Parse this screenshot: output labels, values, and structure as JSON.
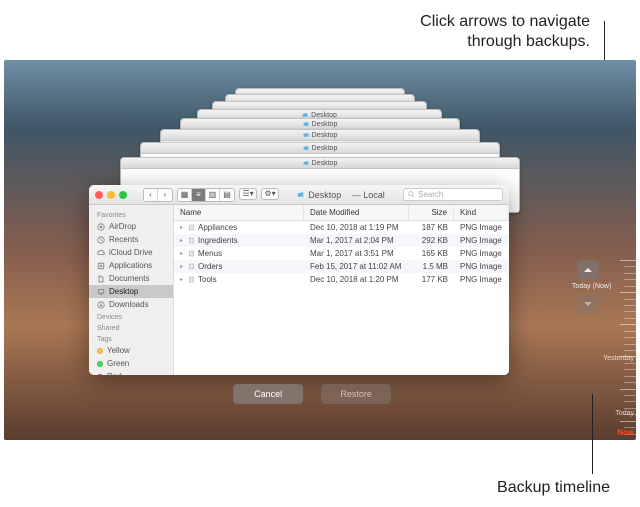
{
  "annotations": {
    "top": "Click arrows to navigate\nthrough backups.",
    "bottom": "Backup timeline"
  },
  "stacked_title": "Desktop",
  "window": {
    "title_folder": "Desktop",
    "title_suffix": "— Local",
    "search_placeholder": "Search"
  },
  "sidebar": {
    "sections": [
      {
        "heading": "Favorites",
        "items": [
          {
            "label": "AirDrop",
            "icon": "airdrop-icon"
          },
          {
            "label": "Recents",
            "icon": "clock-icon"
          },
          {
            "label": "iCloud Drive",
            "icon": "cloud-icon"
          },
          {
            "label": "Applications",
            "icon": "app-icon"
          },
          {
            "label": "Documents",
            "icon": "doc-icon"
          },
          {
            "label": "Desktop",
            "icon": "desktop-icon",
            "selected": true
          },
          {
            "label": "Downloads",
            "icon": "download-icon"
          }
        ]
      },
      {
        "heading": "Devices",
        "items": []
      },
      {
        "heading": "Shared",
        "items": []
      },
      {
        "heading": "Tags",
        "items": [
          {
            "label": "Yellow",
            "color": "#f7c94b"
          },
          {
            "label": "Green",
            "color": "#4cd964"
          },
          {
            "label": "Red",
            "color": "#ff3b30"
          }
        ]
      }
    ]
  },
  "columns": {
    "name": "Name",
    "date": "Date Modified",
    "size": "Size",
    "kind": "Kind"
  },
  "files": [
    {
      "name": "Appliances",
      "date": "Dec 10, 2018 at 1:19 PM",
      "size": "187 KB",
      "kind": "PNG Image"
    },
    {
      "name": "Ingredients",
      "date": "Mar 1, 2017 at 2:04 PM",
      "size": "292 KB",
      "kind": "PNG Image"
    },
    {
      "name": "Menus",
      "date": "Mar 1, 2017 at 3:51 PM",
      "size": "165 KB",
      "kind": "PNG Image"
    },
    {
      "name": "Orders",
      "date": "Feb 15, 2017 at 11:02 AM",
      "size": "1.5 MB",
      "kind": "PNG Image"
    },
    {
      "name": "Tools",
      "date": "Dec 10, 2018 at 1:20 PM",
      "size": "177 KB",
      "kind": "PNG Image"
    }
  ],
  "navigation": {
    "current_label": "Today (Now)"
  },
  "timeline": {
    "labels": [
      "Yesterday",
      "Today"
    ],
    "now": "Now"
  },
  "buttons": {
    "cancel": "Cancel",
    "restore": "Restore"
  }
}
